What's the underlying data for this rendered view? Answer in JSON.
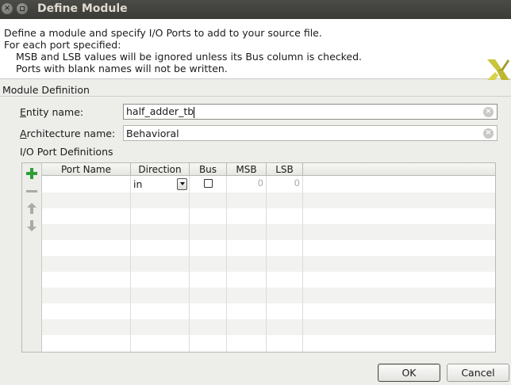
{
  "window": {
    "title": "Define Module"
  },
  "header": {
    "line1": "Define a module and specify I/O Ports to add to your source file.",
    "line2": "For each port specified:",
    "line3": "MSB and LSB values will be ignored unless its Bus column is checked.",
    "line4": "Ports with blank names will not be written."
  },
  "module_definition": {
    "section_label": "Module Definition",
    "entity_label_u": "E",
    "entity_label_rest": "ntity name:",
    "entity_value": "half_adder_tb",
    "arch_label_u": "A",
    "arch_label_rest": "rchitecture name:",
    "arch_value": "Behavioral"
  },
  "ports": {
    "section_label": "I/O Port Definitions",
    "columns": [
      "Port Name",
      "Direction",
      "Bus",
      "MSB",
      "LSB"
    ],
    "rows": [
      {
        "port_name": "",
        "direction": "in",
        "bus": false,
        "msb": "0",
        "lsb": "0"
      }
    ]
  },
  "buttons": {
    "ok": "OK",
    "cancel": "Cancel"
  },
  "icons": {
    "add": "plus-icon",
    "remove": "minus-icon",
    "up": "arrow-up-icon",
    "down": "arrow-down-icon",
    "accent_add": "#2e9e3a"
  }
}
